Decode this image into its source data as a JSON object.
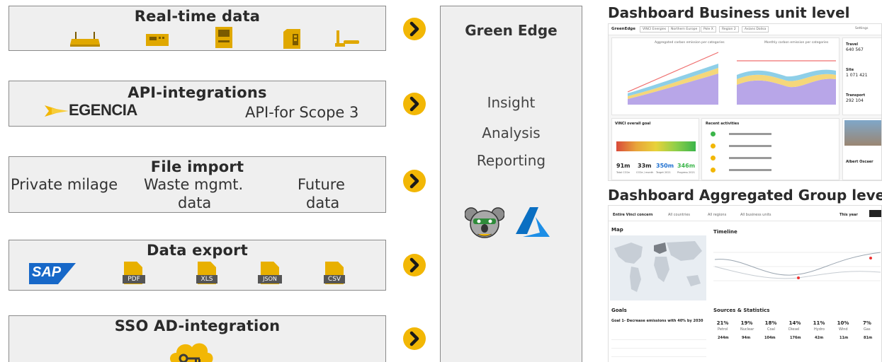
{
  "sources": [
    {
      "title": "Real-time data"
    },
    {
      "title": "API-integrations",
      "brand": "EGENCIA",
      "note": "API-for Scope 3"
    },
    {
      "title": "File import",
      "items": [
        "Private milage",
        "Waste mgmt.",
        "data",
        "Future",
        "data"
      ]
    },
    {
      "title": "Data export",
      "formats": [
        "SAP",
        "PDF",
        "XLS",
        "JSON",
        "CSV"
      ]
    },
    {
      "title": "SSO AD-integration"
    }
  ],
  "green_edge": {
    "title": "Green Edge",
    "features": [
      "Insight",
      "Analysis",
      "Reporting"
    ]
  },
  "dashboards": [
    {
      "title": "Dashboard Business unit level",
      "app_name": "GreenEdge",
      "filters": [
        "VINCI Energies",
        "Northern Europe",
        "Pole X",
        "Region 2",
        "Axians Dalisa"
      ],
      "settings": "Settings",
      "chart1_title": "Aggregated carbon emission per categories",
      "chart2_title": "Monthly carbon emission per categories",
      "side_values": [
        "Travel",
        "640 567",
        "Site",
        "1 071 421",
        "Transport",
        "292 104",
        "Albert Oscaer"
      ],
      "goal_title": "VINCI overall goal",
      "goal_stats": [
        "91m",
        "33m",
        "350m",
        "346m"
      ],
      "goal_stat_labels": [
        "Total CO2e",
        "CO2e / month",
        "Target 2021",
        "Progress 2021"
      ],
      "activities_title": "Recent activities"
    },
    {
      "title": "Dashboard Aggregated Group leve",
      "filter_labels": [
        "Entire Vinci concern",
        "All countries",
        "All regions",
        "All business units"
      ],
      "timeframe": "This year",
      "map_title": "Map",
      "timeline_title": "Timeline",
      "goals_title": "Goals",
      "goal_text": "Goal 1- Decrease emissions with 40% by 2030",
      "sources_title": "Sources & Statistics",
      "stats": [
        {
          "pct": "21%",
          "label": "Petrol",
          "val": "244m"
        },
        {
          "pct": "19%",
          "label": "Nuclear",
          "val": "94m"
        },
        {
          "pct": "18%",
          "label": "Coal",
          "val": "104m"
        },
        {
          "pct": "14%",
          "label": "Diesel",
          "val": "176m"
        },
        {
          "pct": "11%",
          "label": "Hydro",
          "val": "42m"
        },
        {
          "pct": "10%",
          "label": "Wind",
          "val": "11m"
        },
        {
          "pct": "7%",
          "label": "Gas",
          "val": "81m"
        }
      ]
    }
  ],
  "colors": {
    "accent": "#f2b705",
    "box_bg": "#efefef",
    "border": "#8a8a8a",
    "azure": "#0a6fc2",
    "sap": "#1768c8"
  }
}
